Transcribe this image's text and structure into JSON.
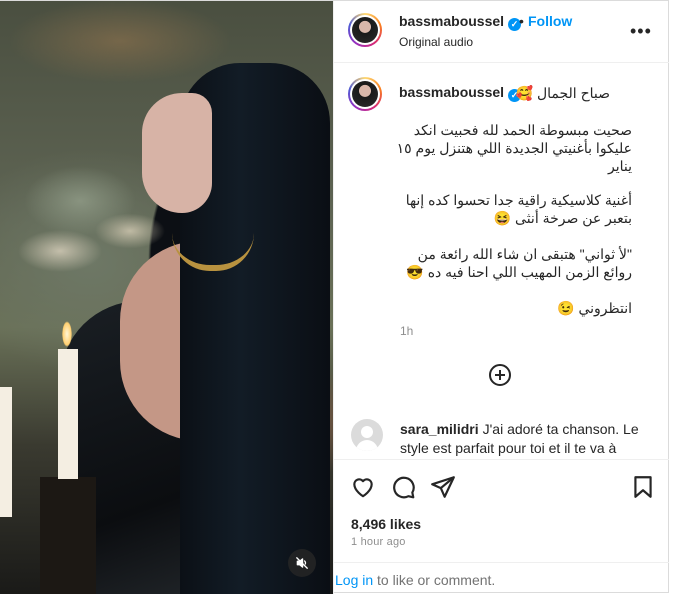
{
  "header": {
    "username": "bassmaboussel",
    "verified_icon": "verified-badge-icon",
    "separator": "•",
    "follow_label": "Follow",
    "audio_label": "Original audio",
    "more_icon": "more-options-icon"
  },
  "caption": {
    "username": "bassmaboussel",
    "first_line": "صباح الجمال 🥰",
    "paragraph1": "صحيت مبسوطة الحمد لله فحبيت انكد عليكوا بأغنيتي الجديدة اللي هتنزل يوم ١٥ يناير",
    "paragraph2": "أغنية كلاسيكية راقية جدا تحسوا كده إنها بتعبر عن صرخة أنثى 😆",
    "paragraph3": "\"لأ ثواني\" هتبقى ان شاء الله رائعة من روائع الزمن المهيب اللي احنا فيه ده 😎",
    "paragraph4": "انتظروني 😉",
    "time": "1h"
  },
  "comment": {
    "username": "sara_milidri",
    "text": "J'ai adoré ta chanson. Le style est parfait pour toi et il te va à"
  },
  "actions": {
    "likes": "8,496 likes",
    "time_ago": "1 hour ago",
    "login_link": "Log in",
    "login_suffix": " to like or comment."
  },
  "media": {
    "mute_icon": "muted-speaker-icon"
  },
  "colors": {
    "accent": "#0095f6",
    "text": "#262626",
    "muted": "#8e8e8e",
    "border": "#efefef"
  }
}
